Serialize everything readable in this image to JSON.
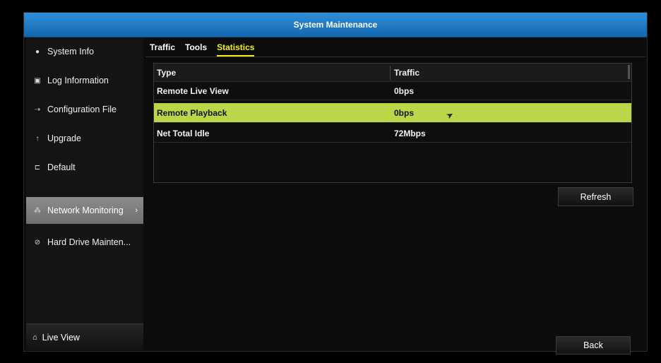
{
  "window": {
    "title": "System Maintenance"
  },
  "sidebar": {
    "items": [
      {
        "label": "System Info",
        "icon": "info-icon"
      },
      {
        "label": "Log Information",
        "icon": "log-icon"
      },
      {
        "label": "Configuration File",
        "icon": "config-file-icon"
      },
      {
        "label": "Upgrade",
        "icon": "upgrade-icon"
      },
      {
        "label": "Default",
        "icon": "default-icon"
      },
      {
        "label": "Network Monitoring",
        "icon": "network-icon",
        "active": true
      },
      {
        "label": "Hard Drive Mainten...",
        "icon": "hard-drive-icon"
      }
    ],
    "live_view": "Live View"
  },
  "tabs": [
    {
      "label": "Traffic"
    },
    {
      "label": "Tools"
    },
    {
      "label": "Statistics",
      "active": true
    }
  ],
  "table": {
    "headers": [
      "Type",
      "Traffic"
    ],
    "rows": [
      {
        "type": "Remote Live View",
        "traffic": "0bps"
      },
      {
        "type": "Remote Playback",
        "traffic": "0bps",
        "selected": true
      },
      {
        "type": "Net Total Idle",
        "traffic": "72Mbps"
      }
    ]
  },
  "buttons": {
    "refresh": "Refresh",
    "back": "Back"
  },
  "colors": {
    "title_bar": "#1d74c4",
    "active_tab": "#f3ef1e",
    "selected_row": "#bcd64a"
  }
}
